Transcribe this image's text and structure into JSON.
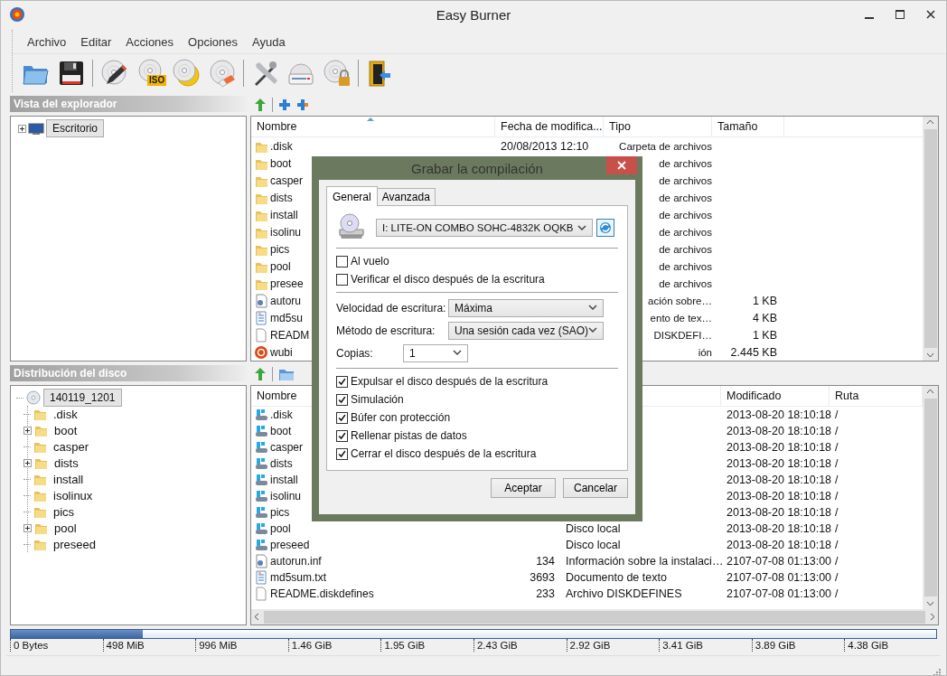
{
  "window": {
    "title": "Easy Burner"
  },
  "menu": [
    "Archivo",
    "Editar",
    "Acciones",
    "Opciones",
    "Ayuda"
  ],
  "toolbar": [
    {
      "kind": "open"
    },
    {
      "kind": "save"
    },
    {
      "kind": "sep"
    },
    {
      "kind": "write"
    },
    {
      "kind": "iso",
      "badge": "ISO"
    },
    {
      "kind": "copy"
    },
    {
      "kind": "erase"
    },
    {
      "kind": "sep"
    },
    {
      "kind": "tools"
    },
    {
      "kind": "drive"
    },
    {
      "kind": "lock"
    },
    {
      "kind": "sep"
    },
    {
      "kind": "exit"
    }
  ],
  "explorer": {
    "title": "Vista del explorador",
    "tree": [
      {
        "label": "Escritorio",
        "collapsed": true,
        "selected": true
      }
    ]
  },
  "files": {
    "columns": {
      "name": "Nombre",
      "date": "Fecha de modifica...",
      "type": "Tipo",
      "size": "Tamaño"
    },
    "rows": [
      {
        "kind": "folder",
        "name": ".disk",
        "date": "20/08/2013 12:10",
        "type": "Carpeta de archivos"
      },
      {
        "kind": "folder",
        "name": "boot",
        "type": "de archivos"
      },
      {
        "kind": "folder",
        "name": "casper",
        "type": "de archivos"
      },
      {
        "kind": "folder",
        "name": "dists",
        "type": "de archivos"
      },
      {
        "kind": "folder",
        "name": "install",
        "type": "de archivos"
      },
      {
        "kind": "folder",
        "name": "isolinu",
        "type": "de archivos"
      },
      {
        "kind": "folder",
        "name": "pics",
        "type": "de archivos"
      },
      {
        "kind": "folder",
        "name": "pool",
        "type": "de archivos"
      },
      {
        "kind": "folder",
        "name": "presee",
        "type": "de archivos"
      },
      {
        "kind": "config",
        "name": "autoru",
        "type": "ación sobre…",
        "size": "1 KB"
      },
      {
        "kind": "text",
        "name": "md5su",
        "type": "ento de tex…",
        "size": "4 KB"
      },
      {
        "kind": "file",
        "name": "READM",
        "type": "DISKDEFI…",
        "size": "1 KB"
      },
      {
        "kind": "app",
        "name": "wubi",
        "type": "ión",
        "size": "2.445 KB"
      }
    ]
  },
  "layout": {
    "title": "Distribución del disco",
    "tree": {
      "label": "140119_1201",
      "selected": true,
      "children": [
        {
          "label": ".disk",
          "collapsed": false
        },
        {
          "label": "boot",
          "collapsed": true
        },
        {
          "label": "casper",
          "collapsed": false
        },
        {
          "label": "dists",
          "collapsed": true
        },
        {
          "label": "install",
          "collapsed": false
        },
        {
          "label": "isolinux",
          "collapsed": false
        },
        {
          "label": "pics",
          "collapsed": false
        },
        {
          "label": "pool",
          "collapsed": true
        },
        {
          "label": "preseed",
          "collapsed": false
        }
      ]
    }
  },
  "disc_files": {
    "columns": {
      "name": "Nombre",
      "modified": "Modificado",
      "path": "Ruta"
    },
    "rows": [
      {
        "kind": "drive",
        "name": ".disk",
        "modified": "2013-08-20 18:10:18",
        "path": "/"
      },
      {
        "kind": "drive",
        "name": "boot",
        "modified": "2013-08-20 18:10:18",
        "path": "/"
      },
      {
        "kind": "drive",
        "name": "casper",
        "modified": "2013-08-20 18:10:18",
        "path": "/"
      },
      {
        "kind": "drive",
        "name": "dists",
        "modified": "2013-08-20 18:10:18",
        "path": "/"
      },
      {
        "kind": "drive",
        "name": "install",
        "modified": "2013-08-20 18:10:18",
        "path": "/"
      },
      {
        "kind": "drive",
        "name": "isolinu",
        "modified": "2013-08-20 18:10:18",
        "path": "/"
      },
      {
        "kind": "drive",
        "name": "pics",
        "modified": "2013-08-20 18:10:18",
        "path": "/"
      },
      {
        "kind": "drive",
        "name": "pool",
        "type": "Disco local",
        "modified": "2013-08-20 18:10:18",
        "path": "/"
      },
      {
        "kind": "drive",
        "name": "preseed",
        "type": "Disco local",
        "modified": "2013-08-20 18:10:18",
        "path": "/"
      },
      {
        "kind": "config",
        "name": "autorun.inf",
        "size": "134",
        "type": "Información sobre la instalaci…",
        "modified": "2107-07-08 01:13:00",
        "path": "/"
      },
      {
        "kind": "text",
        "name": "md5sum.txt",
        "size": "3693",
        "type": "Documento de texto",
        "modified": "2107-07-08 01:13:00",
        "path": "/"
      },
      {
        "kind": "file",
        "name": "README.diskdefines",
        "size": "233",
        "type": "Archivo DISKDEFINES",
        "modified": "2107-07-08 01:13:00",
        "path": "/"
      }
    ]
  },
  "capacity": {
    "level": 0.143,
    "ticks": [
      "0 Bytes",
      "498 MiB",
      "996 MiB",
      "1.46 GiB",
      "1.95 GiB",
      "2.43 GiB",
      "2.92 GiB",
      "3.41 GiB",
      "3.89 GiB",
      "4.38 GiB"
    ]
  },
  "dialog": {
    "title": "Grabar la compilación",
    "tabs": [
      {
        "label": "General",
        "selected": true
      },
      {
        "label": "Avanzada",
        "selected": false
      }
    ],
    "drive": "I: LITE-ON COMBO SOHC-4832K OQKB",
    "options_top": [
      {
        "label": "Al vuelo",
        "checked": false
      },
      {
        "label": "Verificar el disco después de la escritura",
        "checked": false
      }
    ],
    "fields": [
      {
        "kind": "wide",
        "label": "Velocidad de escritura:",
        "value": "Máxima"
      },
      {
        "kind": "wide",
        "label": "Método de escritura:",
        "value": "Una sesión cada vez (SAO)"
      },
      {
        "kind": "short",
        "label": "Copias:",
        "value": "1"
      }
    ],
    "options_bottom": [
      {
        "label": "Expulsar el disco después de la escritura",
        "checked": true
      },
      {
        "label": "Simulación",
        "checked": true
      },
      {
        "label": "Búfer con protección",
        "checked": true
      },
      {
        "label": "Rellenar pistas de datos",
        "checked": true
      },
      {
        "label": "Cerrar el disco después de la escritura",
        "checked": true
      }
    ],
    "buttons": [
      "Aceptar",
      "Cancelar"
    ]
  }
}
